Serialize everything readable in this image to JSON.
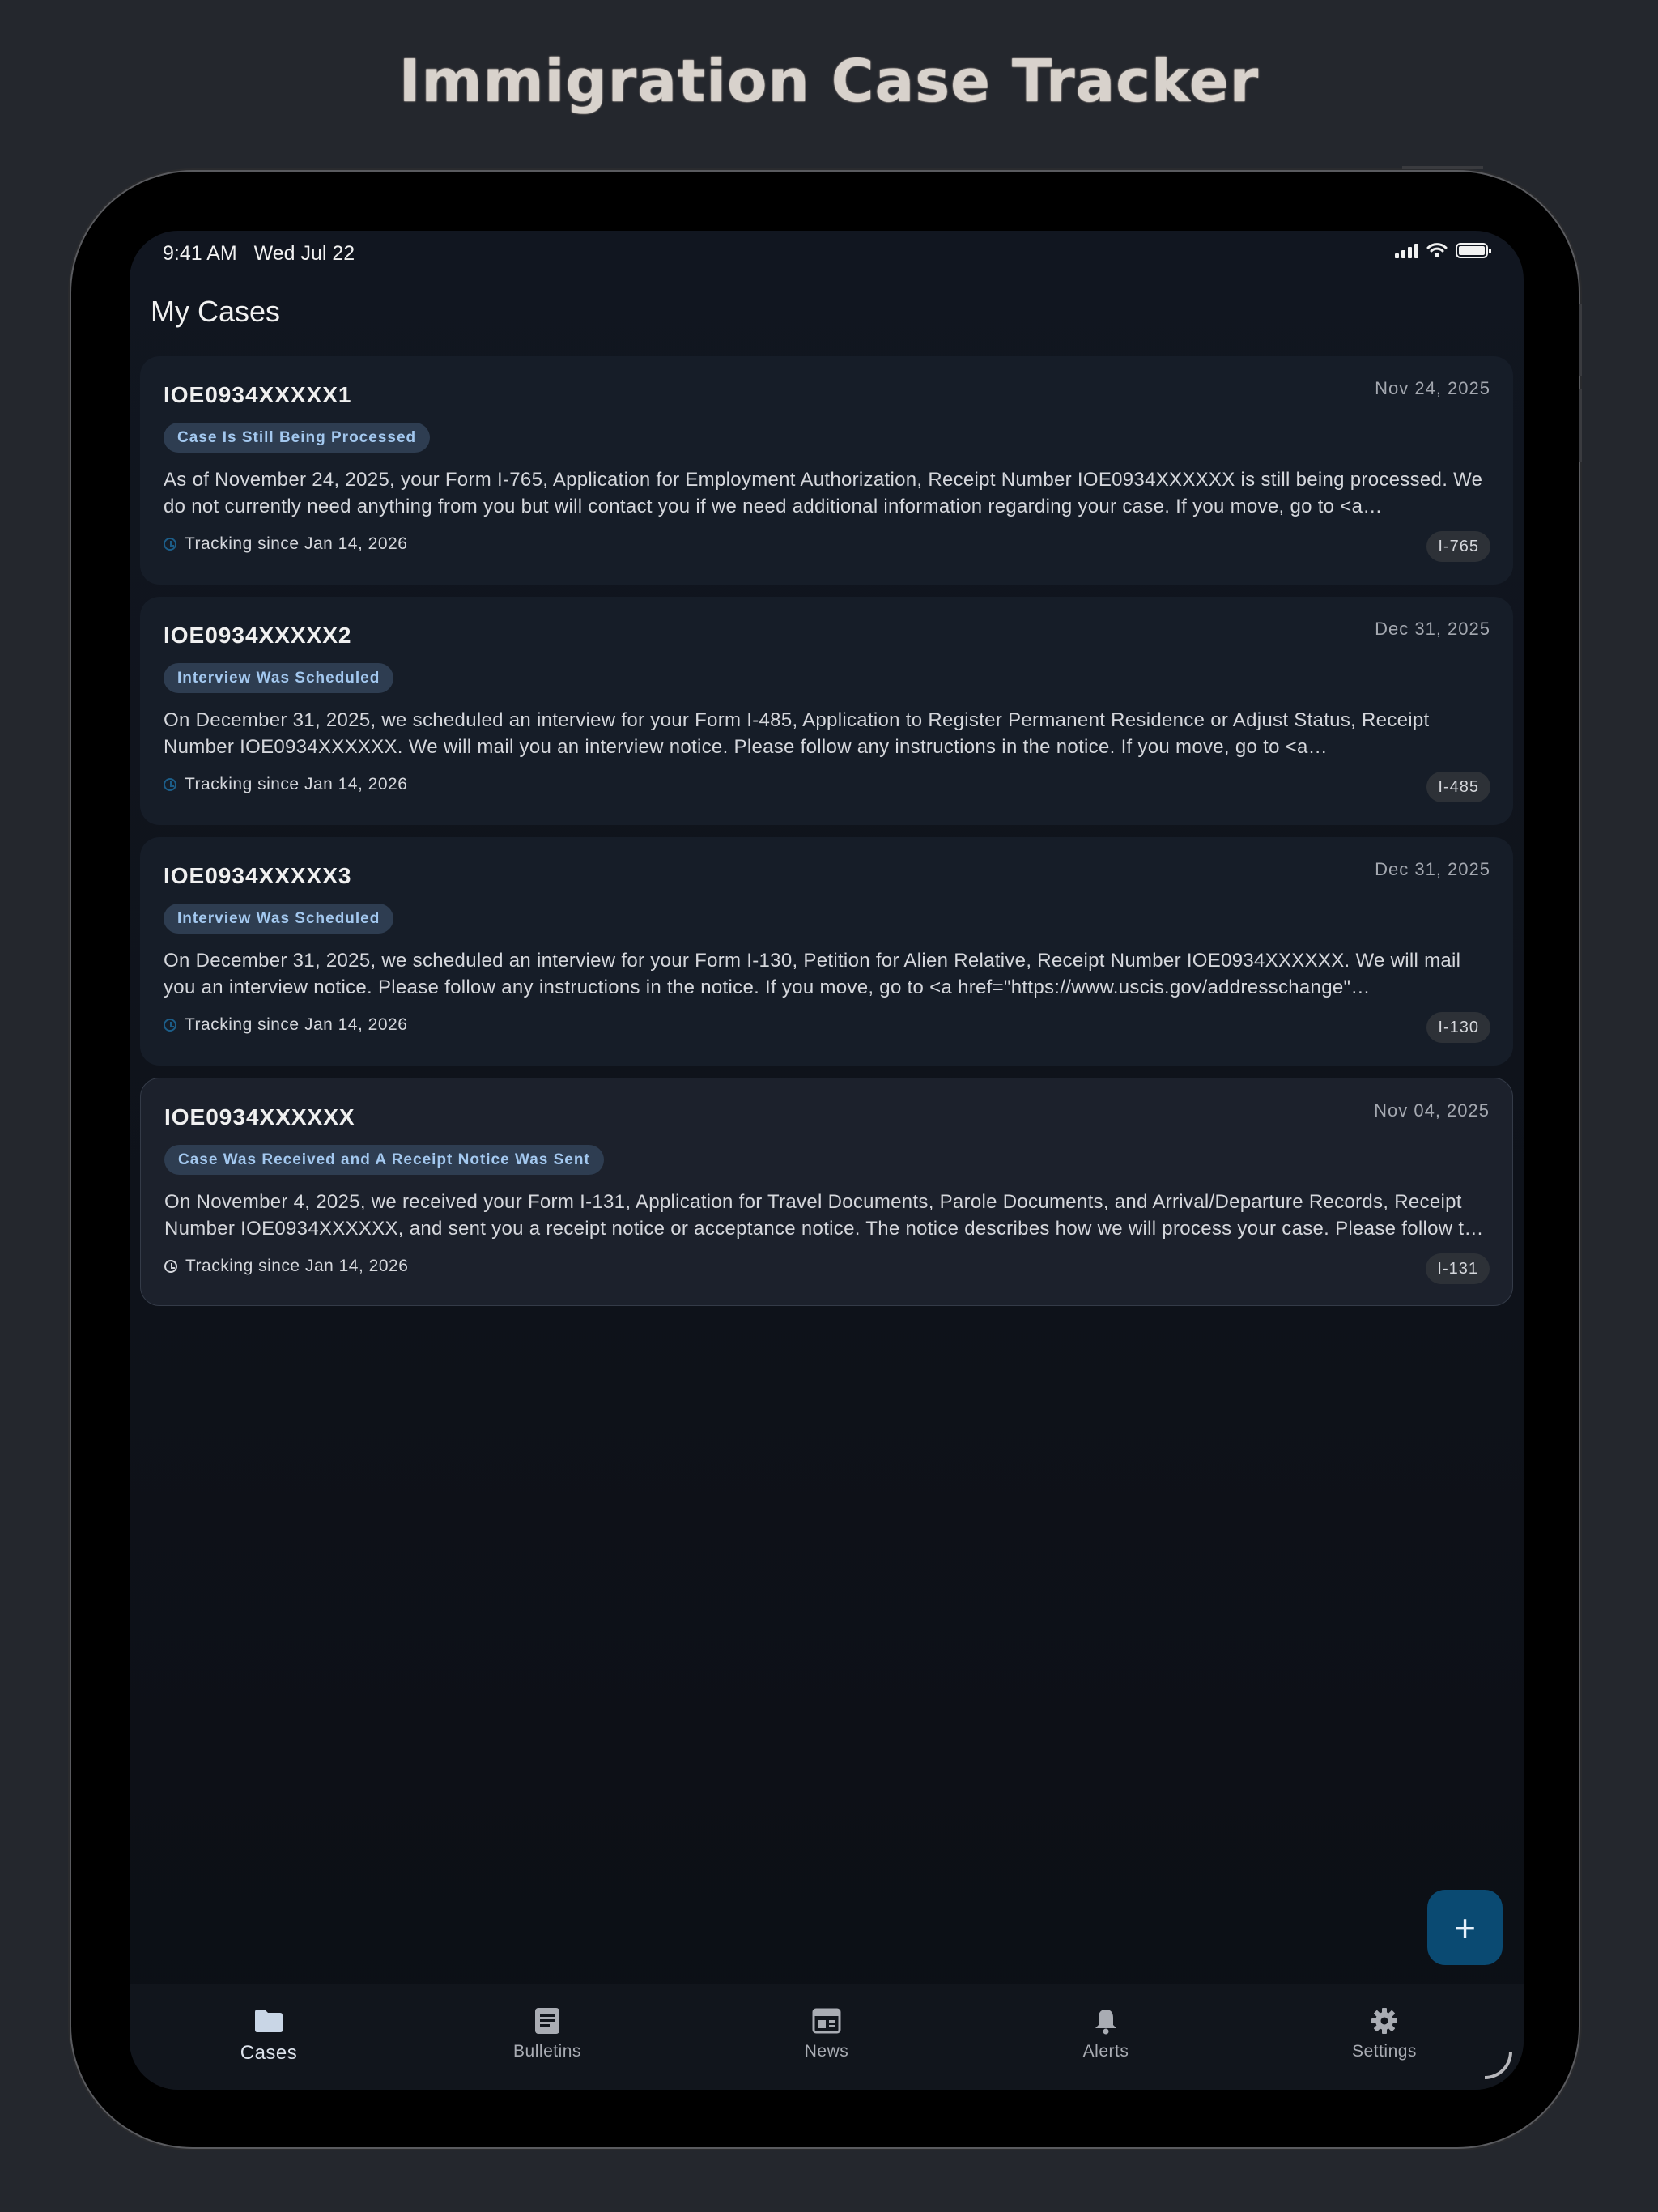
{
  "headline": "Immigration Case Tracker",
  "status_bar": {
    "time": "9:41 AM",
    "date": "Wed Jul 22"
  },
  "page_title": "My Cases",
  "cases": [
    {
      "receipt": "IOE0934XXXXX1",
      "date": "Nov 24, 2025",
      "status": "Case Is Still Being Processed",
      "description": "As of November 24, 2025, your Form I-765, Application for Employment Authorization, Receipt Number IOE0934XXXXXX is still being processed. We do not currently need anything from you but will contact you if we need additional information regarding your case. If you move, go to <a href=\"https://www.uscis.gov/addresschange\" target=\"_blank\">www.uscis.gov/addresschange</a> to give us your new mailing address.",
      "tracking": "Tracking since Jan 14, 2026",
      "form": "I-765"
    },
    {
      "receipt": "IOE0934XXXXX2",
      "date": "Dec 31, 2025",
      "status": "Interview Was Scheduled",
      "description": "On December 31, 2025, we scheduled an interview for your Form I-485, Application to Register Permanent Residence or Adjust Status, Receipt Number IOE0934XXXXXX. We will mail you an interview notice. Please follow any instructions in the notice. If you move, go to <a href=\"https://www.uscis.gov/addresschange\" target=\"_blank\">www.uscis.gov/addresschange</a> to give us your new mailing address.",
      "tracking": "Tracking since Jan 14, 2026",
      "form": "I-485"
    },
    {
      "receipt": "IOE0934XXXXX3",
      "date": "Dec 31, 2025",
      "status": "Interview Was Scheduled",
      "description": "On December 31, 2025, we scheduled an interview for your Form I-130, Petition for Alien Relative, Receipt Number IOE0934XXXXXX. We will mail you an interview notice. Please follow any instructions in the notice. If you move, go to <a href=\"https://www.uscis.gov/addresschange\" target=\"_blank\">www.uscis.gov/addresschange</a> to give us your new mailing address.",
      "tracking": "Tracking since Jan 14, 2026",
      "form": "I-130"
    },
    {
      "receipt": "IOE0934XXXXXX",
      "date": "Nov 04, 2025",
      "status": "Case Was Received and A Receipt Notice Was Sent",
      "description": "On November 4, 2025, we received your Form I-131, Application for Travel Documents, Parole Documents, and Arrival/Departure Records, Receipt Number IOE0934XXXXXX, and sent you a receipt notice or acceptance notice. The notice describes how we will process your case. Please follow the instructions in the notice.",
      "tracking": "Tracking since Jan 14, 2026",
      "form": "I-131"
    }
  ],
  "fab": {
    "label": "+"
  },
  "tabs": [
    {
      "label": "Cases",
      "icon": "folder-icon",
      "active": true
    },
    {
      "label": "Bulletins",
      "icon": "article-icon"
    },
    {
      "label": "News",
      "icon": "newspaper-icon"
    },
    {
      "label": "Alerts",
      "icon": "bell-icon"
    },
    {
      "label": "Settings",
      "icon": "gear-icon"
    }
  ],
  "colors": {
    "background": "#24272d",
    "screen": "#0c0f15",
    "card": "#161d28",
    "status_chip": "#2e3d51",
    "status_chip_text": "#a3c8ef",
    "fab": "#0a4a72"
  }
}
